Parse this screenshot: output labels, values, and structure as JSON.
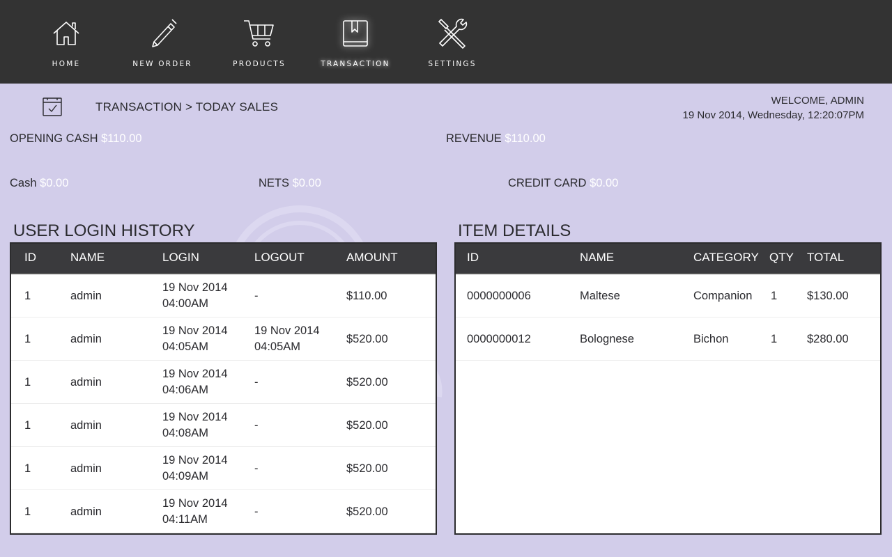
{
  "nav": {
    "items": [
      {
        "label": "HOME",
        "icon": "home-icon"
      },
      {
        "label": "NEW ORDER",
        "icon": "pencil-icon"
      },
      {
        "label": "PRODUCTS",
        "icon": "cart-icon"
      },
      {
        "label": "TRANSACTION",
        "icon": "book-icon",
        "active": true
      },
      {
        "label": "SETTINGS",
        "icon": "tools-icon"
      }
    ]
  },
  "header": {
    "breadcrumb": "TRANSACTION > TODAY SALES",
    "welcome": "WELCOME, ADMIN",
    "datetime": "19 Nov 2014, Wednesday, 12:20:07PM"
  },
  "stats": {
    "opening_cash": {
      "label": "OPENING CASH",
      "value": "$110.00"
    },
    "revenue": {
      "label": "REVENUE",
      "value": "$110.00"
    },
    "cash": {
      "label": "Cash",
      "value": "$0.00"
    },
    "nets": {
      "label": "NETS",
      "value": "$0.00"
    },
    "credit_card": {
      "label": "CREDIT CARD",
      "value": "$0.00"
    }
  },
  "login_history": {
    "title": "USER LOGIN HISTORY",
    "columns": [
      "ID",
      "NAME",
      "LOGIN",
      "LOGOUT",
      "AMOUNT"
    ],
    "rows": [
      {
        "id": "1",
        "name": "admin",
        "login_date": "19 Nov 2014",
        "login_time": "04:00AM",
        "logout_date": "-",
        "logout_time": "",
        "amount": "$110.00"
      },
      {
        "id": "1",
        "name": "admin",
        "login_date": "19 Nov 2014",
        "login_time": "04:05AM",
        "logout_date": "19 Nov 2014",
        "logout_time": "04:05AM",
        "amount": "$520.00"
      },
      {
        "id": "1",
        "name": "admin",
        "login_date": "19 Nov 2014",
        "login_time": "04:06AM",
        "logout_date": "-",
        "logout_time": "",
        "amount": "$520.00"
      },
      {
        "id": "1",
        "name": "admin",
        "login_date": "19 Nov 2014",
        "login_time": "04:08AM",
        "logout_date": "-",
        "logout_time": "",
        "amount": "$520.00"
      },
      {
        "id": "1",
        "name": "admin",
        "login_date": "19 Nov 2014",
        "login_time": "04:09AM",
        "logout_date": "-",
        "logout_time": "",
        "amount": "$520.00"
      },
      {
        "id": "1",
        "name": "admin",
        "login_date": "19 Nov 2014",
        "login_time": "04:11AM",
        "logout_date": "-",
        "logout_time": "",
        "amount": "$520.00"
      }
    ]
  },
  "item_details": {
    "title": "ITEM DETAILS",
    "columns": [
      "ID",
      "NAME",
      "CATEGORY",
      "QTY",
      "TOTAL"
    ],
    "rows": [
      {
        "id": "0000000006",
        "name": "Maltese",
        "category": "Companion",
        "qty": "1",
        "total": "$130.00"
      },
      {
        "id": "0000000012",
        "name": "Bolognese",
        "category": "Bichon",
        "qty": "1",
        "total": "$280.00"
      }
    ]
  },
  "colors": {
    "background": "#d2cdea",
    "topbar": "#333333",
    "table_header": "#3a3a3d",
    "value_highlight": "#ffffff"
  }
}
